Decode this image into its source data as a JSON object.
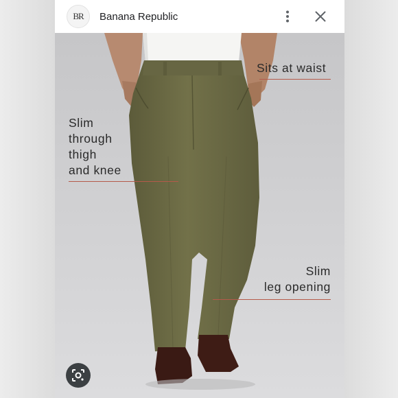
{
  "header": {
    "logo_text": "BR",
    "brand_name": "Banana Republic",
    "more_icon": "kebab-vertical-icon",
    "close_icon": "close-icon"
  },
  "image": {
    "callouts": {
      "waist": "Sits at waist",
      "thigh": [
        "Slim",
        "through",
        "thigh",
        "and knee"
      ],
      "leg": [
        "Slim",
        "leg opening"
      ]
    },
    "lens_icon": "google-lens-icon"
  },
  "colors": {
    "pants": "#6b6a45",
    "shirt": "#f5f5f3",
    "callout_line": "#b55a4a",
    "photo_bg": "#cfcfd1"
  }
}
